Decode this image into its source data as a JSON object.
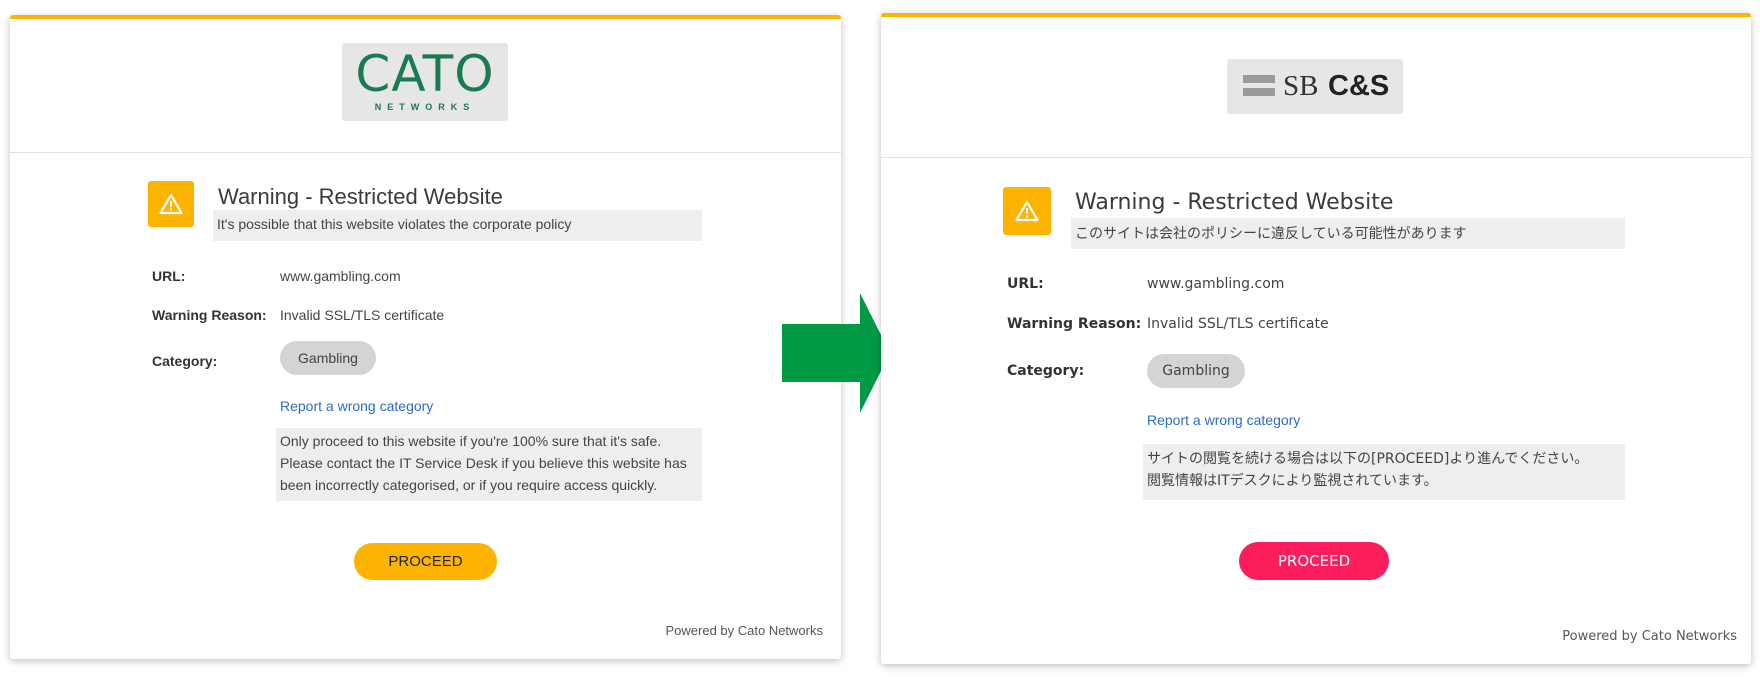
{
  "left": {
    "logo": {
      "main": "CATO",
      "sub": "NETWORKS"
    },
    "title": "Warning - Restricted Website",
    "subtitle": "It's possible that this website violates the corporate policy",
    "url_label": "URL:",
    "url_value": "www.gambling.com",
    "reason_label": "Warning Reason:",
    "reason_value": "Invalid SSL/TLS certificate",
    "category_label": "Category:",
    "category_value": "Gambling",
    "report_link": "Report a wrong category",
    "note_lines": [
      "Only proceed to this website if you're 100% sure that it's safe.",
      "Please contact the IT Service Desk if you believe this website has",
      "been incorrectly categorised, or if you require access quickly."
    ],
    "proceed_label": "PROCEED",
    "powered_by": "Powered by Cato Networks",
    "colors": {
      "accent": "#fcb400",
      "proceed": "#fcb400",
      "logo_text": "#1a7a52"
    }
  },
  "right": {
    "logo": {
      "sb": "SB",
      "cs": "C&S"
    },
    "title": "Warning - Restricted Website",
    "subtitle": "このサイトは会社のポリシーに違反している可能性があります",
    "url_label": "URL:",
    "url_value": "www.gambling.com",
    "reason_label": "Warning Reason:",
    "reason_value": "Invalid SSL/TLS certificate",
    "category_label": "Category:",
    "category_value": "Gambling",
    "report_link": "Report a wrong category",
    "note_lines": [
      "サイトの閲覧を続ける場合は以下の[PROCEED]より進んでください。",
      "閲覧情報はITデスクにより監視されています。"
    ],
    "proceed_label": "PROCEED",
    "powered_by": "Powered by Cato Networks",
    "colors": {
      "accent": "#fcb400",
      "proceed": "#fc1d5c"
    }
  },
  "arrow": {
    "color": "#009944",
    "icon": "right-arrow-icon"
  }
}
